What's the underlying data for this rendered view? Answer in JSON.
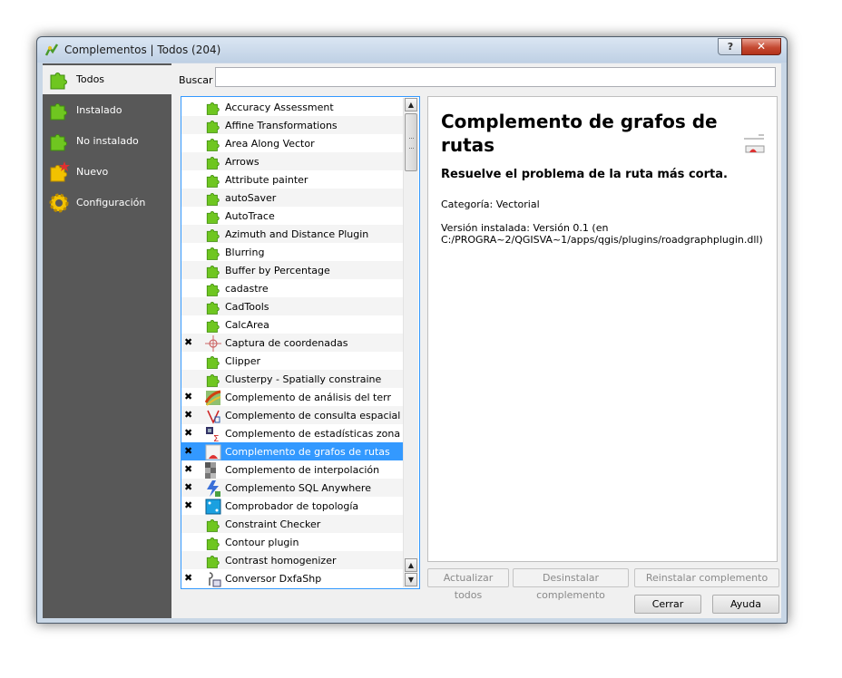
{
  "window": {
    "title": "Complementos | Todos (204)",
    "help": "?",
    "close": "✕"
  },
  "sidebar": {
    "items": [
      {
        "label": "Todos",
        "icon": "puzzle-icon"
      },
      {
        "label": "Instalado",
        "icon": "puzzle-icon"
      },
      {
        "label": "No instalado",
        "icon": "puzzle-icon"
      },
      {
        "label": "Nuevo",
        "icon": "puzzle-star-icon"
      },
      {
        "label": "Configuración",
        "icon": "gear-icon"
      }
    ]
  },
  "search": {
    "label": "Buscar",
    "value": ""
  },
  "plugins": [
    {
      "name": "Accuracy Assessment",
      "checked": false,
      "icon": "puzzle"
    },
    {
      "name": "Affine Transformations",
      "checked": false,
      "icon": "puzzle"
    },
    {
      "name": "Area Along Vector",
      "checked": false,
      "icon": "puzzle"
    },
    {
      "name": "Arrows",
      "checked": false,
      "icon": "puzzle"
    },
    {
      "name": "Attribute painter",
      "checked": false,
      "icon": "puzzle"
    },
    {
      "name": "autoSaver",
      "checked": false,
      "icon": "puzzle"
    },
    {
      "name": "AutoTrace",
      "checked": false,
      "icon": "puzzle"
    },
    {
      "name": "Azimuth and Distance Plugin",
      "checked": false,
      "icon": "puzzle"
    },
    {
      "name": "Blurring",
      "checked": false,
      "icon": "puzzle"
    },
    {
      "name": "Buffer by Percentage",
      "checked": false,
      "icon": "puzzle"
    },
    {
      "name": "cadastre",
      "checked": false,
      "icon": "puzzle"
    },
    {
      "name": "CadTools",
      "checked": false,
      "icon": "puzzle"
    },
    {
      "name": "CalcArea",
      "checked": false,
      "icon": "puzzle"
    },
    {
      "name": "Captura de coordenadas",
      "checked": true,
      "icon": "crosshair"
    },
    {
      "name": "Clipper",
      "checked": false,
      "icon": "puzzle"
    },
    {
      "name": "Clusterpy - Spatially constraine",
      "checked": false,
      "icon": "puzzle"
    },
    {
      "name": "Complemento de análisis del terr",
      "checked": true,
      "icon": "terrain"
    },
    {
      "name": "Complemento de consulta espacial",
      "checked": true,
      "icon": "spatial-query"
    },
    {
      "name": "Complemento de estadísticas zona",
      "checked": true,
      "icon": "zonal-stats"
    },
    {
      "name": "Complemento de grafos de rutas",
      "checked": true,
      "icon": "road-graph",
      "selected": true
    },
    {
      "name": "Complemento de interpolación",
      "checked": true,
      "icon": "interpolation"
    },
    {
      "name": "Complemento SQL Anywhere",
      "checked": true,
      "icon": "sql-anywhere"
    },
    {
      "name": "Comprobador de topología",
      "checked": true,
      "icon": "topology"
    },
    {
      "name": "Constraint Checker",
      "checked": false,
      "icon": "puzzle"
    },
    {
      "name": "Contour plugin",
      "checked": false,
      "icon": "puzzle"
    },
    {
      "name": "Contrast homogenizer",
      "checked": false,
      "icon": "puzzle"
    },
    {
      "name": "Conversor DxfaShp",
      "checked": true,
      "icon": "dxf"
    }
  ],
  "details": {
    "title": "Complemento de grafos de rutas",
    "subtitle": "Resuelve el problema de la ruta más corta.",
    "category": "Categoría: Vectorial",
    "version_line1": "Versión instalada: Versión 0.1 (en",
    "version_line2": "C:/PROGRA~2/QGISVA~1/apps/qgis/plugins/roadgraphplugin.dll)"
  },
  "actions": {
    "upgrade_all": "Actualizar todos",
    "uninstall": "Desinstalar complemento",
    "reinstall": "Reinstalar complemento",
    "close": "Cerrar",
    "help": "Ayuda"
  }
}
